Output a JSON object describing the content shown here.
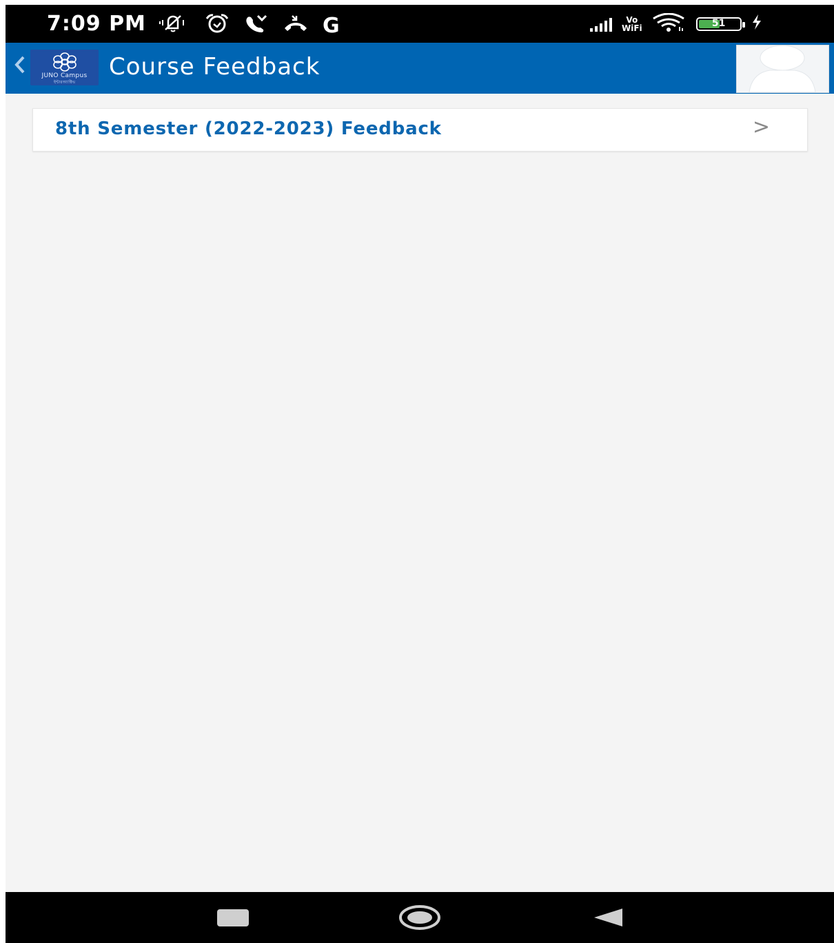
{
  "status_bar": {
    "time": "7:09 PM",
    "left_icons": [
      "mute-icon",
      "alarm-icon",
      "missed-call-icon",
      "call-icon",
      "google-icon"
    ],
    "google_glyph": "G",
    "vowifi_top": "Vo",
    "vowifi_bottom": "WiFi",
    "battery_level": "51",
    "charging": true
  },
  "app_bar": {
    "title": "Course Feedback",
    "logo_text": "JUNO Campus",
    "logo_subtext": "ইন্টারঅ্যাক্টিভ",
    "back_icon": "chevron-left-icon",
    "avatar_icon": "user-avatar-placeholder"
  },
  "feedback_list": {
    "items": [
      {
        "label": "8th Semester (2022-2023) Feedback",
        "chevron": ">"
      }
    ]
  },
  "nav_bar": {
    "buttons": [
      "recents-button",
      "home-button",
      "back-button"
    ]
  },
  "colors": {
    "app_bar": "#0065b3",
    "link_text": "#0d67b0",
    "background": "#f4f4f4",
    "status_bar": "#000000"
  }
}
